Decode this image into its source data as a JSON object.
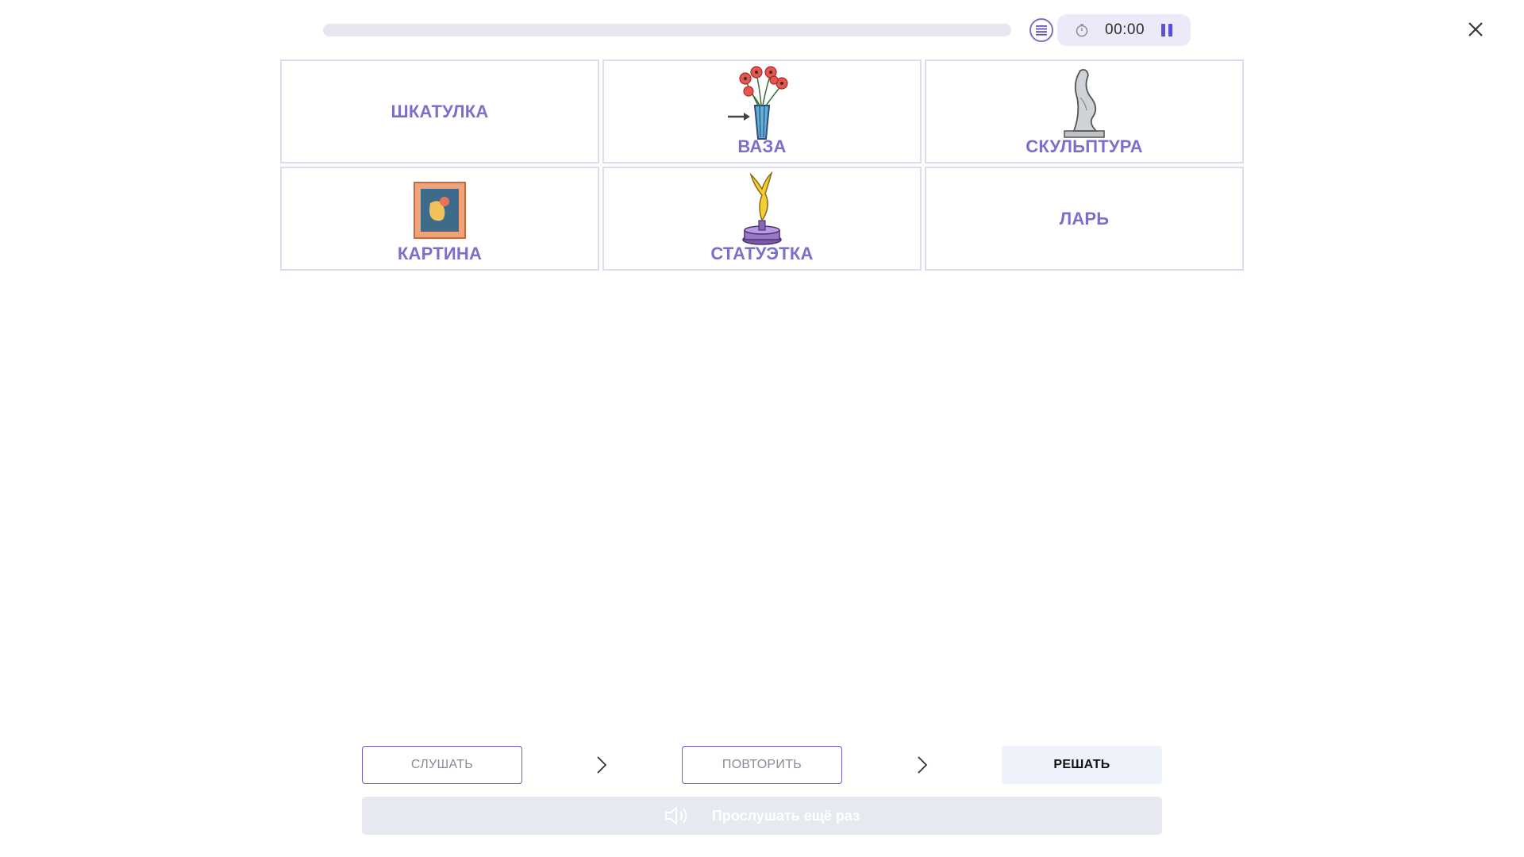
{
  "header": {
    "progress_fraction": 0,
    "timer": "00:00",
    "icons": {
      "menu": "list-icon",
      "timer": "stopwatch-icon",
      "pause": "pause-icon",
      "close": "close-icon"
    }
  },
  "cards": [
    {
      "label": "ШКАТУЛКА",
      "image": ""
    },
    {
      "label": "ВАЗА",
      "image": "vase-with-flowers"
    },
    {
      "label": "СКУЛЬПТУРА",
      "image": "abstract-sculpture"
    },
    {
      "label": "КАРТИНА",
      "image": "framed-painting"
    },
    {
      "label": "СТАТУЭТКА",
      "image": "golden-statuette"
    },
    {
      "label": "ЛАРЬ",
      "image": ""
    }
  ],
  "steps": {
    "listen": "СЛУШАТЬ",
    "repeat": "ПОВТОРИТЬ",
    "solve": "РЕШАТЬ"
  },
  "listen_again": "Прослушать ещё раз",
  "colors": {
    "accent": "#7c6fc9",
    "card_border": "#dcdcec",
    "solve_bg": "#eef3fb",
    "listen_bar_bg": "#e6e9f0"
  }
}
